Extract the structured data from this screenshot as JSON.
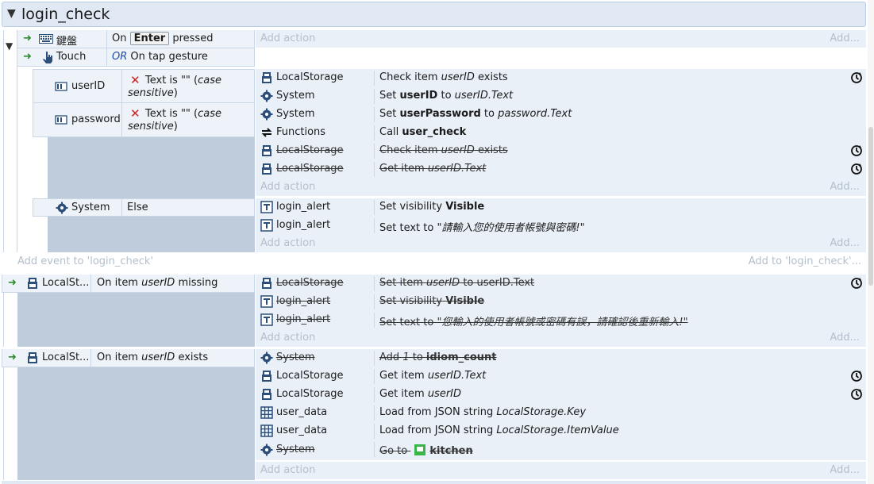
{
  "group": {
    "title": "login_check"
  },
  "event1": {
    "cond_keyboard_obj": "鍵盤",
    "cond_keyboard_on": "On",
    "cond_keyboard_key": "Enter",
    "cond_keyboard_pressed": "pressed",
    "cond_touch_obj": "Touch",
    "cond_touch_or": "OR",
    "cond_touch_text": "On tap gesture",
    "add_action": "Add action",
    "add_more": "Add..."
  },
  "sub1": {
    "cond_userid_obj": "userID",
    "cond_userid_text": "Text is \"\" (",
    "cond_userid_case": "case sensitive",
    "cond_userid_close": ")",
    "cond_password_obj": "password",
    "cond_password_text": "Text is \"\" (",
    "cond_password_case": "case sensitive",
    "cond_password_close": ")",
    "actions": [
      {
        "obj": "LocalStorage",
        "pre": "Check item ",
        "em": "userID",
        "post": " exists"
      },
      {
        "obj": "System",
        "pre": "Set ",
        "bold": "userID",
        "mid": " to ",
        "em": "userID.Text"
      },
      {
        "obj": "System",
        "pre": "Set ",
        "bold": "userPassword",
        "mid": " to ",
        "em": "password.Text"
      },
      {
        "obj": "Functions",
        "pre": "Call ",
        "bold": "user_check"
      },
      {
        "obj": "LocalStorage",
        "pre": "Check item ",
        "em": "userID",
        "post": " exists"
      },
      {
        "obj": "LocalStorage",
        "pre": "Get item ",
        "em": "userID.Text"
      }
    ],
    "add_action": "Add action",
    "add_more": "Add..."
  },
  "sub2": {
    "cond_obj": "System",
    "cond_text": "Else",
    "actions": [
      {
        "obj": "login_alert",
        "pre": "Set visibility ",
        "bold": "Visible"
      },
      {
        "obj": "login_alert",
        "pre": "Set text to ",
        "em": "\"請輸入您的使用者帳號與密碼!\""
      }
    ],
    "add_action": "Add action",
    "add_more": "Add..."
  },
  "add_event": {
    "label": "Add event to 'login_check'",
    "right": "Add to 'login_check'..."
  },
  "event2": {
    "cond_obj": "LocalSt...",
    "cond_pre": "On item ",
    "cond_em": "userID",
    "cond_post": " missing",
    "actions": [
      {
        "obj": "LocalStorage",
        "pre": "Set item ",
        "em": "userID",
        "post": " to userID.Text"
      },
      {
        "obj": "login_alert",
        "pre": "Set visibility ",
        "bold": "Visible"
      },
      {
        "obj": "login_alert",
        "pre": "Set text to ",
        "em": "\"您輸入的使用者帳號或密碼有誤，請確認後重新輸入!\""
      }
    ],
    "add_action": "Add action",
    "add_more": "Add..."
  },
  "event3": {
    "cond_obj": "LocalSt...",
    "cond_pre": "On item ",
    "cond_em": "userID",
    "cond_post": " exists",
    "actions": [
      {
        "obj": "System",
        "pre": "Add ",
        "em": "1",
        "mid": " to ",
        "bold": "idiom_count"
      },
      {
        "obj": "LocalStorage",
        "pre": "Get item ",
        "em": "userID.Text"
      },
      {
        "obj": "LocalStorage",
        "pre": "Get item ",
        "em": "userID"
      },
      {
        "obj": "user_data",
        "pre": "Load from JSON string ",
        "em": "LocalStorage.Key"
      },
      {
        "obj": "user_data",
        "pre": "Load from JSON string ",
        "em": "LocalStorage.ItemValue"
      },
      {
        "obj": "System",
        "pre": "Go to ",
        "bold": "kitchen"
      }
    ],
    "add_action": "Add action",
    "add_more": "Add..."
  },
  "colors": {
    "accent": "#1f4aa8",
    "header_bg": "#dfe8f3",
    "block_bg": "#bfccdc",
    "action_bg": "#e9f0f8"
  }
}
